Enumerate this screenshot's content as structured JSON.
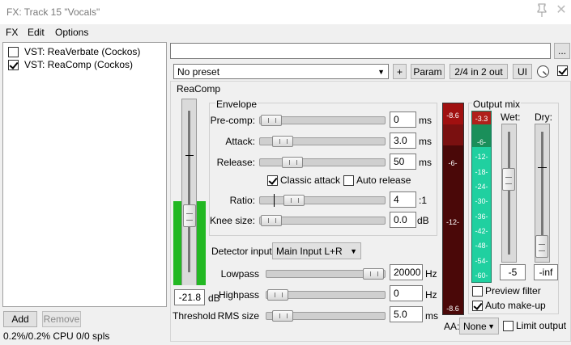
{
  "window": {
    "title": "FX: Track 15 \"Vocals\""
  },
  "menu": {
    "fx": "FX",
    "edit": "Edit",
    "options": "Options"
  },
  "plugins": [
    {
      "label": "VST: ReaVerbate (Cockos)",
      "enabled": false
    },
    {
      "label": "VST: ReaComp (Cockos)",
      "enabled": true
    }
  ],
  "buttons": {
    "add": "Add",
    "remove": "Remove",
    "ellipsis": "...",
    "plus": "+",
    "param": "Param",
    "io": "2/4 in 2 out",
    "ui": "UI"
  },
  "status": "0.2%/0.2% CPU 0/0 spls",
  "preset": {
    "value": "No preset"
  },
  "plugin_name": "ReaComp",
  "envelope": {
    "title": "Envelope",
    "precomp": {
      "label": "Pre-comp:",
      "value": "0",
      "unit": "ms"
    },
    "attack": {
      "label": "Attack:",
      "value": "3.0",
      "unit": "ms"
    },
    "release": {
      "label": "Release:",
      "value": "50",
      "unit": "ms"
    },
    "classic_attack": {
      "label": "Classic attack",
      "checked": true
    },
    "auto_release": {
      "label": "Auto release",
      "checked": false
    },
    "ratio": {
      "label": "Ratio:",
      "value": "4",
      "unit": ":1"
    },
    "knee": {
      "label": "Knee size:",
      "value": "0.0",
      "unit": "dB"
    }
  },
  "threshold": {
    "value": "-21.8",
    "unit": "dB",
    "label": "Threshold"
  },
  "detector": {
    "label": "Detector input:",
    "value": "Main Input L+R",
    "lowpass": {
      "label": "Lowpass",
      "value": "20000",
      "unit": "Hz"
    },
    "highpass": {
      "label": "Highpass",
      "value": "0",
      "unit": "Hz"
    },
    "rms": {
      "label": "RMS size",
      "value": "5.0",
      "unit": "ms"
    }
  },
  "meters": {
    "gr_top": "-8.6",
    "gr_bottom": "-8.6",
    "gr_scale": [
      "-6-",
      "-12-"
    ],
    "out_top": "-3.3",
    "out_scale": [
      "-6-",
      "-12-",
      "-18-",
      "-24-",
      "-30-",
      "-36-",
      "-42-",
      "-48-",
      "-54-",
      "-60-"
    ]
  },
  "output_mix": {
    "title": "Output mix",
    "wet": {
      "label": "Wet:",
      "value": "-5"
    },
    "dry": {
      "label": "Dry:",
      "value": "-inf"
    },
    "preview_filter": {
      "label": "Preview filter",
      "checked": false
    },
    "auto_makeup": {
      "label": "Auto make-up",
      "checked": true
    }
  },
  "aa": {
    "label": "AA:",
    "value": "None"
  },
  "limit_output": {
    "label": "Limit output",
    "checked": false
  },
  "colors": {
    "meter_bg": "#7a0f0f",
    "meter_red": "#a01010",
    "output_green": "#20d0a0",
    "threshold_green": "#22b822"
  }
}
